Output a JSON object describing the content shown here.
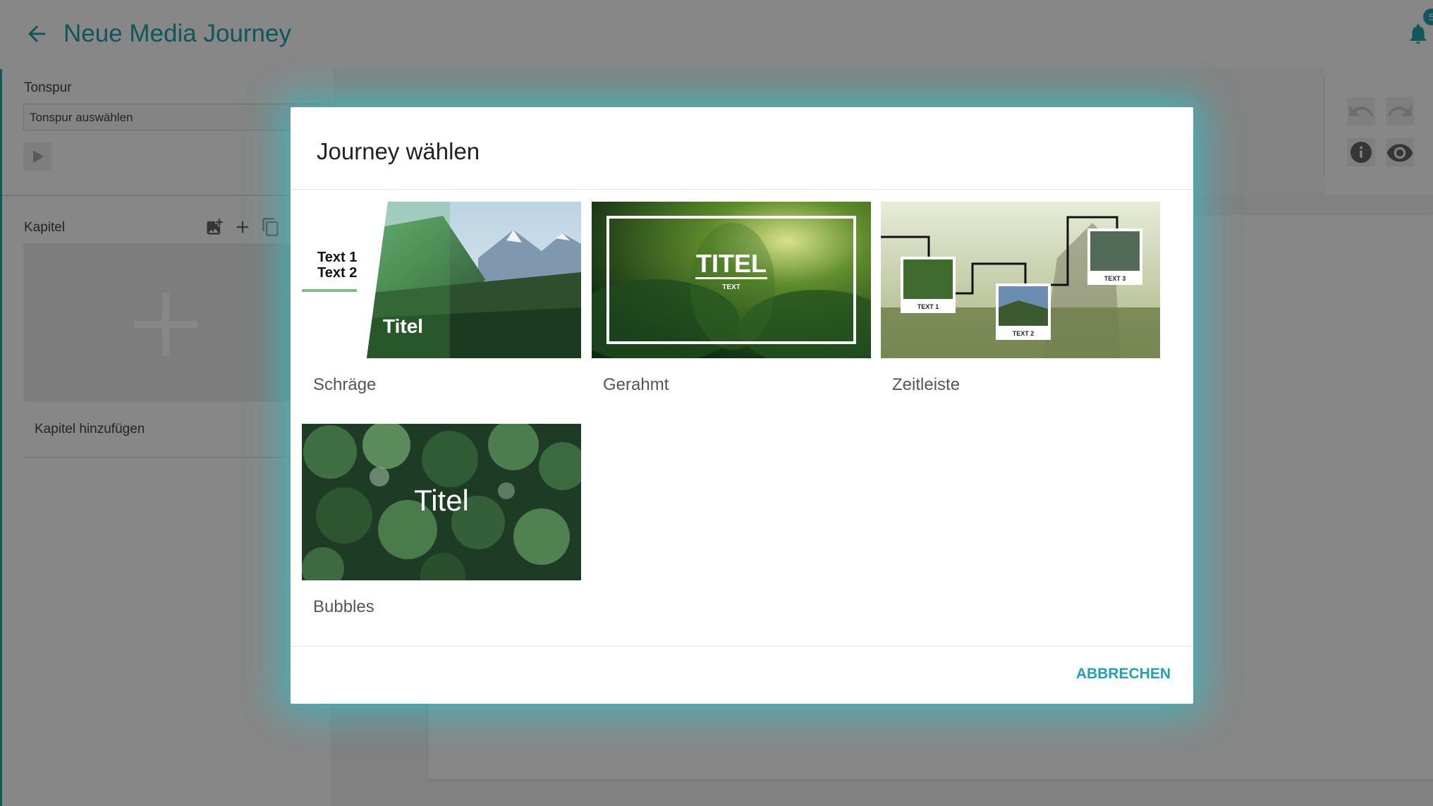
{
  "app": {
    "title": "Neue Media Journey",
    "notification_count": "5",
    "accent_color": "#1fa3ad"
  },
  "sidebar": {
    "tonspur_label": "Tonspur",
    "tonspur_select_value": "Tonspur auswählen",
    "kapitel_label": "Kapitel",
    "kapitel_add_label": "Kapitel hinzufügen"
  },
  "dialog": {
    "title": "Journey wählen",
    "cancel_label": "ABBRECHEN",
    "options": [
      {
        "label": "Schräge",
        "thumb_title": "Titel",
        "thumb_text1": "Text 1",
        "thumb_text2": "Text 2"
      },
      {
        "label": "Gerahmt",
        "thumb_title": "TITEL",
        "thumb_sub": "TEXT"
      },
      {
        "label": "Zeitleiste",
        "thumb_text1": "TEXT 1",
        "thumb_text2": "TEXT 2",
        "thumb_text3": "TEXT 3"
      },
      {
        "label": "Bubbles",
        "thumb_title": "Titel"
      }
    ]
  }
}
